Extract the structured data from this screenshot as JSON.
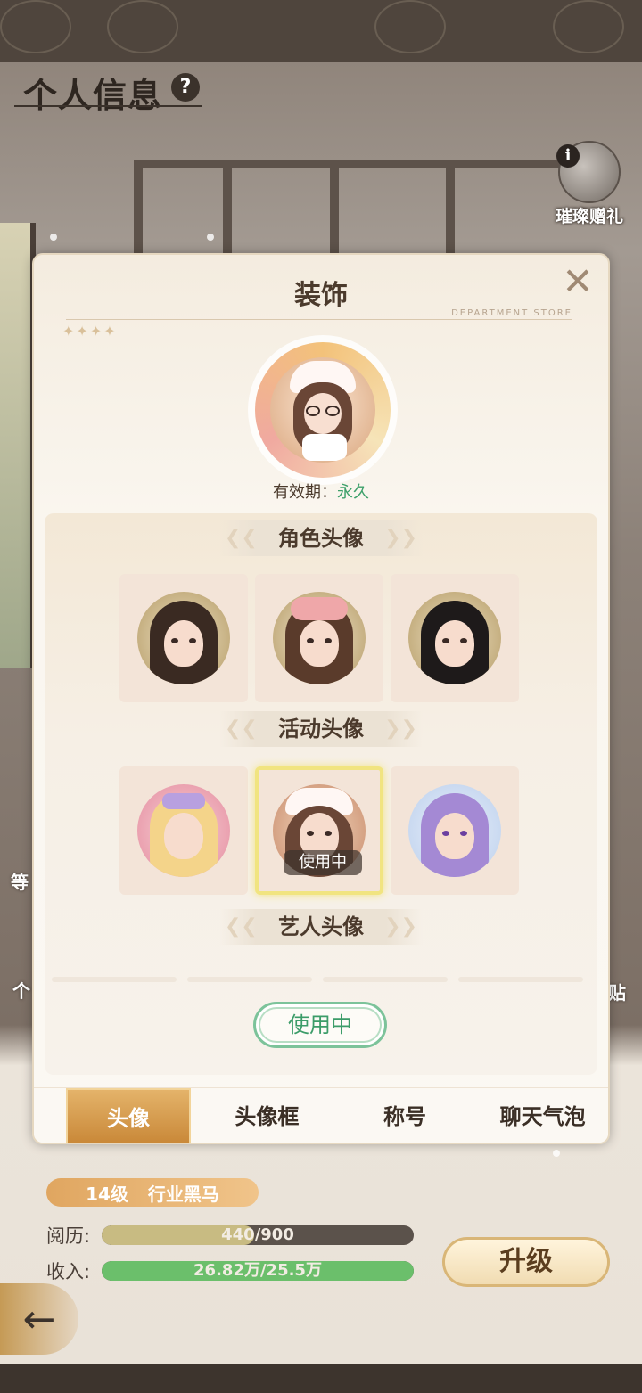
{
  "page": {
    "title": "个人信息",
    "help_glyph": "?",
    "gift_label": "璀璨赠礼",
    "gift_info_glyph": "i"
  },
  "side_fragments": {
    "left_top": "等",
    "left_bottom": "个",
    "right": "贴"
  },
  "modal": {
    "title": "装饰",
    "subtitle": "DEPARTMENT STORE",
    "close_glyph": "✕",
    "sparkles": "✦✦✦✦",
    "validity_label": "有效期：",
    "validity_value": "永久",
    "sections": [
      {
        "title": "角色头像",
        "avatars": [
          "avatar-role-1",
          "avatar-role-2",
          "avatar-role-3"
        ]
      },
      {
        "title": "活动头像",
        "avatars": [
          "avatar-event-1",
          "avatar-event-2",
          "avatar-event-3"
        ]
      },
      {
        "title": "艺人头像",
        "avatars": []
      }
    ],
    "selected_tag": "使用中",
    "action_button": "使用中",
    "tabs": [
      "头像",
      "头像框",
      "称号",
      "聊天气泡"
    ],
    "active_tab": 0
  },
  "profile": {
    "level": "14级",
    "rank": "行业黑马",
    "experience_label": "阅历:",
    "experience_value": "440/900",
    "experience_fraction": 0.489,
    "income_label": "收入:",
    "income_value": "26.82万/25.5万",
    "income_fraction": 1.0,
    "upgrade_label": "升级",
    "back_glyph": "←"
  },
  "colors": {
    "accent_gold": "#c98838",
    "in_use_green": "#3c9c69",
    "exp_fill": "#c8bb82",
    "income_fill": "#6bbf6b"
  }
}
